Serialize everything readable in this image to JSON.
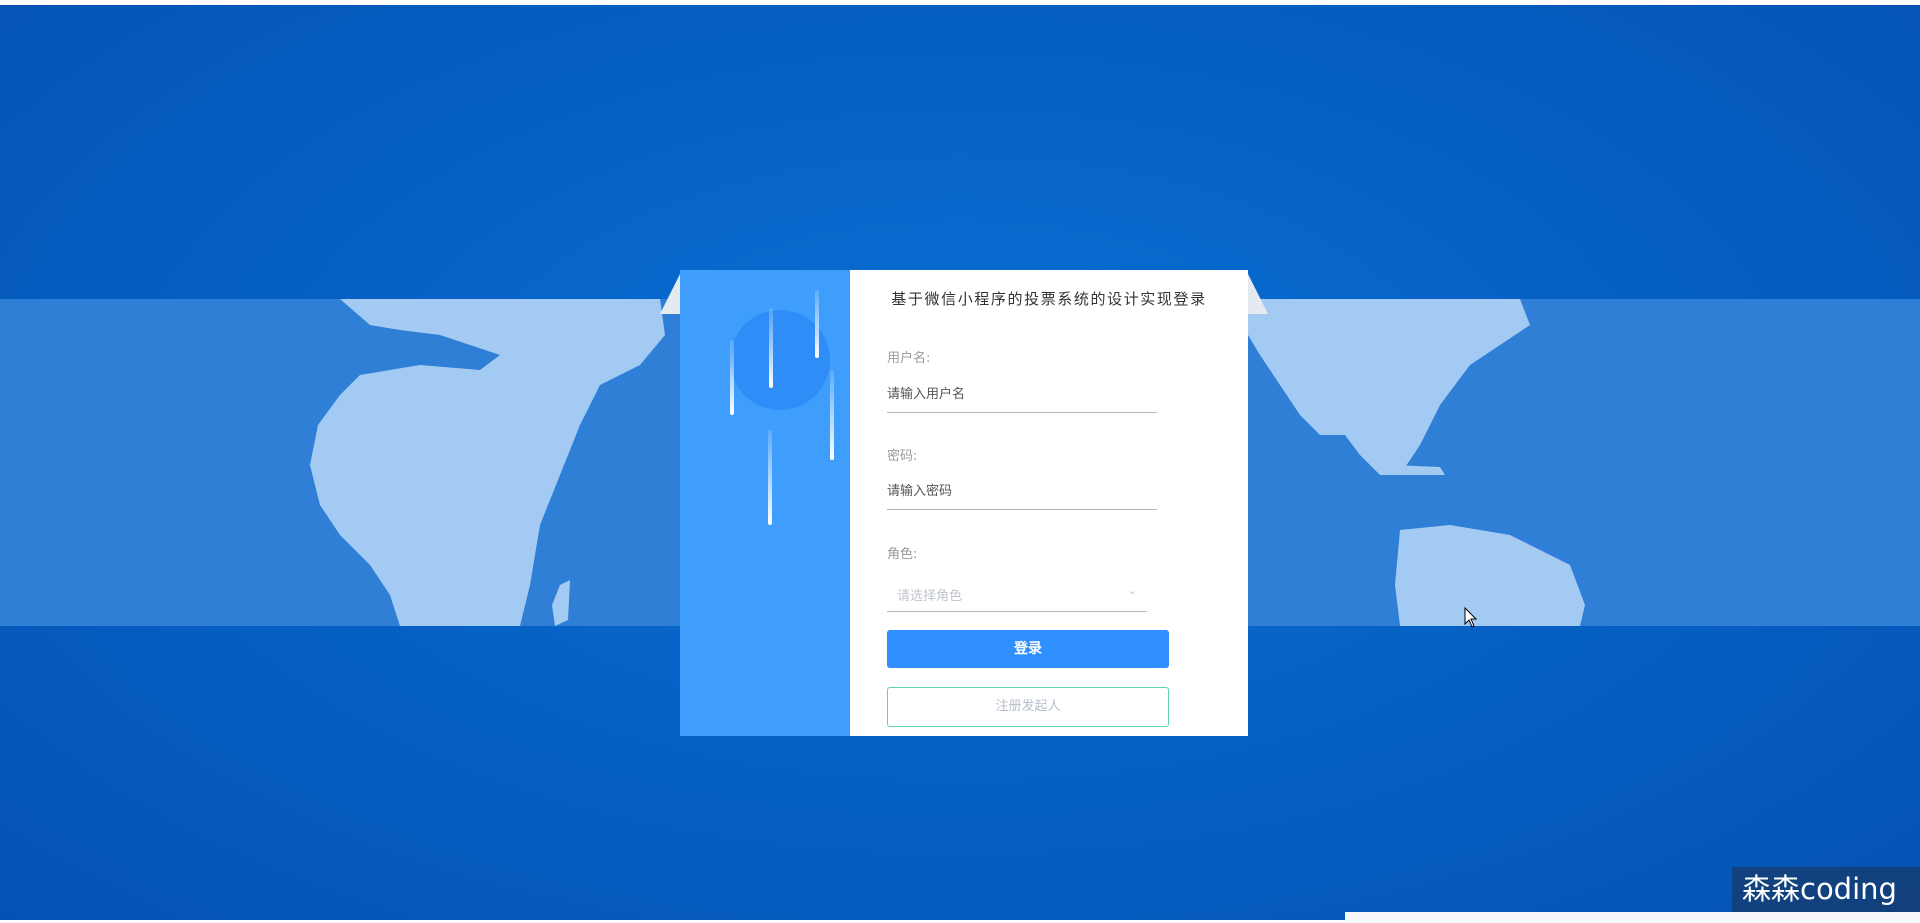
{
  "login_form": {
    "title": "基于微信小程序的投票系统的设计实现登录",
    "username_label": "用户名:",
    "username_placeholder": "请输入用户名",
    "password_label": "密码:",
    "password_placeholder": "请输入密码",
    "role_label": "角色:",
    "role_placeholder": "请选择角色",
    "login_button": "登录",
    "register_button": "注册发起人"
  },
  "watermark": {
    "text": "森森coding"
  },
  "icons": {
    "role_dropdown": "chevron-down-icon",
    "cursor": "mouse-pointer-icon"
  },
  "colors": {
    "background": "#0560c4",
    "primary": "#2f8ffc",
    "register_border": "#5fd3b5"
  }
}
